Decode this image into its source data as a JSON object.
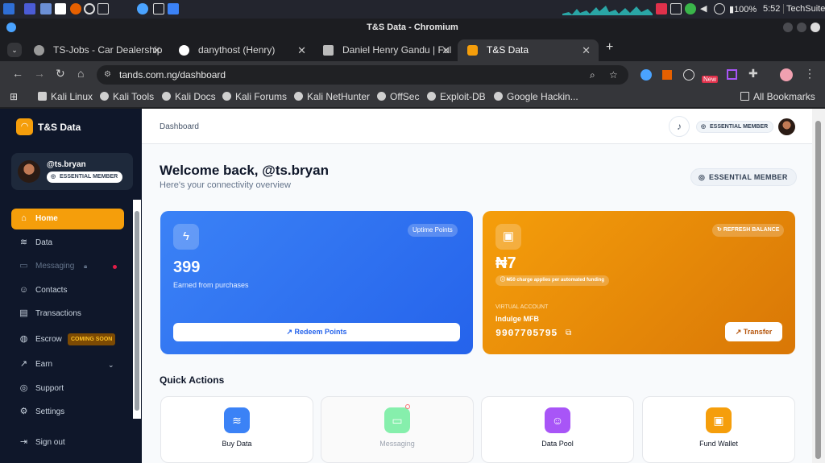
{
  "taskbar": {
    "clock": "5:52",
    "battery": "100%",
    "user": "TechSuite"
  },
  "window": {
    "title": "T&S Data - Chromium"
  },
  "tabs": [
    {
      "label": "TS-Jobs - Car Dealership",
      "active": false
    },
    {
      "label": "danythost (Henry)",
      "active": false
    },
    {
      "label": "Daniel Henry Gandu | Ful",
      "active": false
    },
    {
      "label": "T&S Data",
      "active": true
    }
  ],
  "new_tab": "+",
  "address": {
    "url": "tands.com.ng/dashboard"
  },
  "extensions": {
    "new_badge": "New"
  },
  "bookmarks": [
    "Kali Linux",
    "Kali Tools",
    "Kali Docs",
    "Kali Forums",
    "Kali NetHunter",
    "OffSec",
    "Exploit-DB",
    "Google Hackin..."
  ],
  "all_bookmarks": "All Bookmarks",
  "brand": {
    "name": "T&S Data"
  },
  "profile": {
    "handle": "@ts.bryan",
    "badge": "ESSENTIAL MEMBER"
  },
  "nav": {
    "home": "Home",
    "data": "Data",
    "messaging": "Messaging",
    "contacts": "Contacts",
    "transactions": "Transactions",
    "escrow": "Escrow",
    "escrow_badge": "COMING SOON",
    "earn": "Earn",
    "support": "Support",
    "settings": "Settings",
    "signout": "Sign out"
  },
  "topbar": {
    "breadcrumb": "Dashboard",
    "badge": "ESSENTIAL MEMBER"
  },
  "welcome": {
    "title": "Welcome back, @ts.bryan",
    "subtitle": "Here's your connectivity overview",
    "badge": "ESSENTIAL MEMBER"
  },
  "points_card": {
    "pill": "Uptime Points",
    "value": "399",
    "caption": "Earned from purchases",
    "button": "Redeem Points"
  },
  "wallet_card": {
    "pill": "REFRESH BALANCE",
    "balance": "₦7",
    "charge_note": "₦50 charge applies per automated funding",
    "va_label": "VIRTUAL ACCOUNT",
    "bank": "Indulge MFB",
    "account_number": "9907705795",
    "button": "Transfer"
  },
  "quick_actions": {
    "title": "Quick Actions",
    "items": [
      {
        "label": "Buy Data",
        "color": "#3b82f6"
      },
      {
        "label": "Messaging",
        "color": "#86efac"
      },
      {
        "label": "Data Pool",
        "color": "#a855f7"
      },
      {
        "label": "Fund Wallet",
        "color": "#f59e0b"
      }
    ]
  },
  "colors": {
    "accent": "#f59e0b",
    "blue": "#2563eb",
    "sidebar": "#0f172a"
  }
}
